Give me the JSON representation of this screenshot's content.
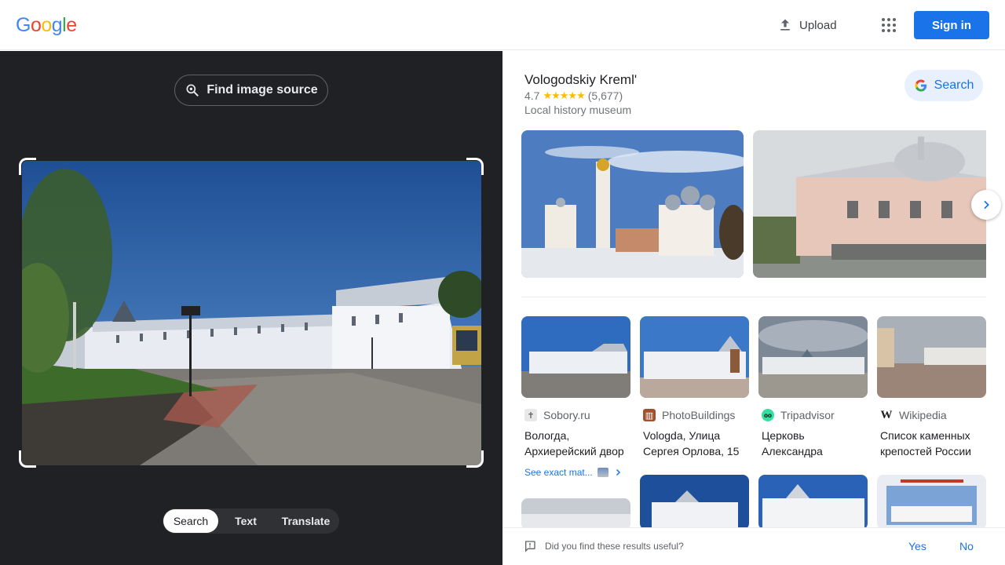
{
  "header": {
    "logo_letters": [
      "G",
      "o",
      "o",
      "g",
      "l",
      "e"
    ],
    "logo_colors": [
      "#4285F4",
      "#EA4335",
      "#FBBC05",
      "#4285F4",
      "#34A853",
      "#EA4335"
    ],
    "upload_label": "Upload",
    "signin_label": "Sign in"
  },
  "left_panel": {
    "find_source_label": "Find image source",
    "modes": [
      "Search",
      "Text",
      "Translate"
    ],
    "active_mode": "Search"
  },
  "knowledge_panel": {
    "title": "Vologodskiy Kreml'",
    "rating": "4.7",
    "stars": "★★★★★",
    "review_count": "(5,677)",
    "type": "Local history museum",
    "search_label": "Search"
  },
  "results": [
    {
      "source": "Sobory.ru",
      "title": "Вологда, Архиерейский двор",
      "favicon": "✝",
      "favicon_bg": "#e8e8e8",
      "favicon_color": "#5f6368"
    },
    {
      "source": "PhotoBuildings",
      "title": "Vologda, Улица Сергея Орлова, 15",
      "favicon": "▥",
      "favicon_bg": "#a0522d",
      "favicon_color": "#ffffff"
    },
    {
      "source": "Tripadvisor",
      "title": "Церковь Александра Невского",
      "favicon": "oo",
      "favicon_bg": "#34e0a1",
      "favicon_color": "#000000"
    },
    {
      "source": "Wikipedia",
      "title": "Список каменных крепостей России",
      "favicon": "W",
      "favicon_bg": "#ffffff",
      "favicon_color": "#202124"
    }
  ],
  "see_exact_label": "See exact mat...",
  "feedback": {
    "question": "Did you find these results useful?",
    "yes": "Yes",
    "no": "No"
  }
}
